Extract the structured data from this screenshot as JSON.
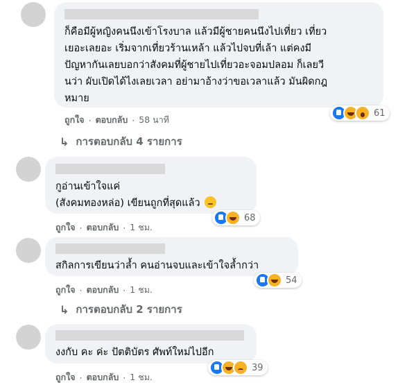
{
  "comments": [
    {
      "text": "ก็คือมีผู้หญิงคนนึงเข้าโรงบาล แล้วมีผู้ชายคนนึงไปเที่ยว เที่ยว\nเยอะเลยอะ เริ่มจากเที่ยวร้านเหล้า แล้วไปจบที่เล้า แต่คงมี\nปัญหากันเลยบอกว่าสังคมที่ผู้ชายไปเที่ยวอะจอมปลอม ก็เลยวี\nนว่า ผับเปิดได้ไงเลยเวลา อย่ามาอ้างว่าขอเวลาแล้ว มันผิดกฎ\nหมาย",
      "like": "ถูกใจ",
      "reply": "ตอบกลับ",
      "time": "58 นาที",
      "reaction_count": "61",
      "reactions": [
        "like-icon",
        "haha-icon",
        "wow-icon"
      ],
      "replies_label": "การตอบกลับ 4 รายการ"
    },
    {
      "text": "กูอ่านเข้าใจแค่\n(สังคมทองหล่อ) เขียนถูกที่สุดแล้ว",
      "like": "ถูกใจ",
      "reply": "ตอบกลับ",
      "time": "1 ชม.",
      "reaction_count": "68",
      "reactions": [
        "like-icon",
        "haha-icon"
      ]
    },
    {
      "text": "สกิลการเขียนว่าล้ำ คนอ่านจบและเข้าใจล้ำกว่า",
      "like": "ถูกใจ",
      "reply": "ตอบกลับ",
      "time": "1 ชม.",
      "reaction_count": "54",
      "reactions": [
        "like-icon",
        "haha-icon"
      ],
      "replies_label": "การตอบกลับ 2 รายการ"
    },
    {
      "text": "งงกับ คะ ค่ะ ปัตติบัตร ศัพท์ใหม่ไปอีก",
      "like": "ถูกใจ",
      "reply": "ตอบกลับ",
      "time": "1 ชม.",
      "reaction_count": "39",
      "reactions": [
        "like-icon",
        "haha-icon",
        "sad-icon"
      ]
    }
  ],
  "colors": {
    "bubble": "#f0f2f5",
    "meta": "#65676b",
    "like_blue": "#1877f2",
    "emoji_yellow": "#f7b125"
  }
}
